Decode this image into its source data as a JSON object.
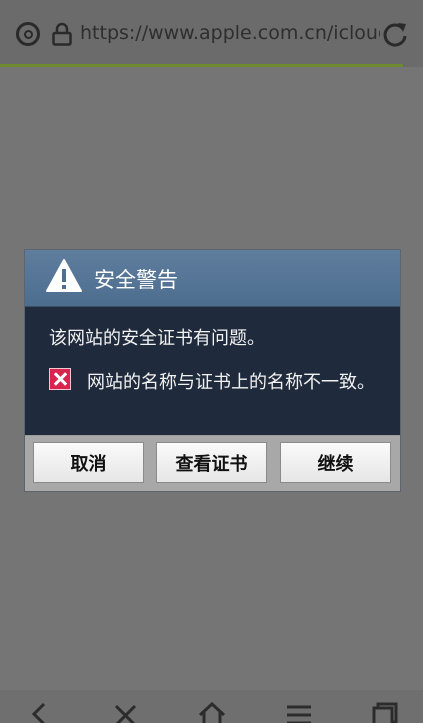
{
  "browser": {
    "url": "https://www.apple.com.cn/icloud/...",
    "icons": [
      "shield-icon",
      "lock-icon",
      "refresh-icon"
    ],
    "progress_color": "#6e8a2e",
    "progress_fraction": 0.95
  },
  "dialog": {
    "title": "安全警告",
    "message": "该网站的安全证书有问题。",
    "error_text": "网站的名称与证书上的名称不一致。",
    "icons": [
      "warning-icon",
      "error-x-icon"
    ],
    "buttons": {
      "cancel": "取消",
      "view_certificate": "查看证书",
      "continue": "继续"
    },
    "colors": {
      "header": "#55759a",
      "body": "#1f2b3c",
      "error_icon": "#d8254f"
    }
  },
  "bottom_nav": {
    "icons": [
      "back-icon",
      "close-icon",
      "home-icon",
      "menu-icon",
      "tabs-icon"
    ]
  }
}
